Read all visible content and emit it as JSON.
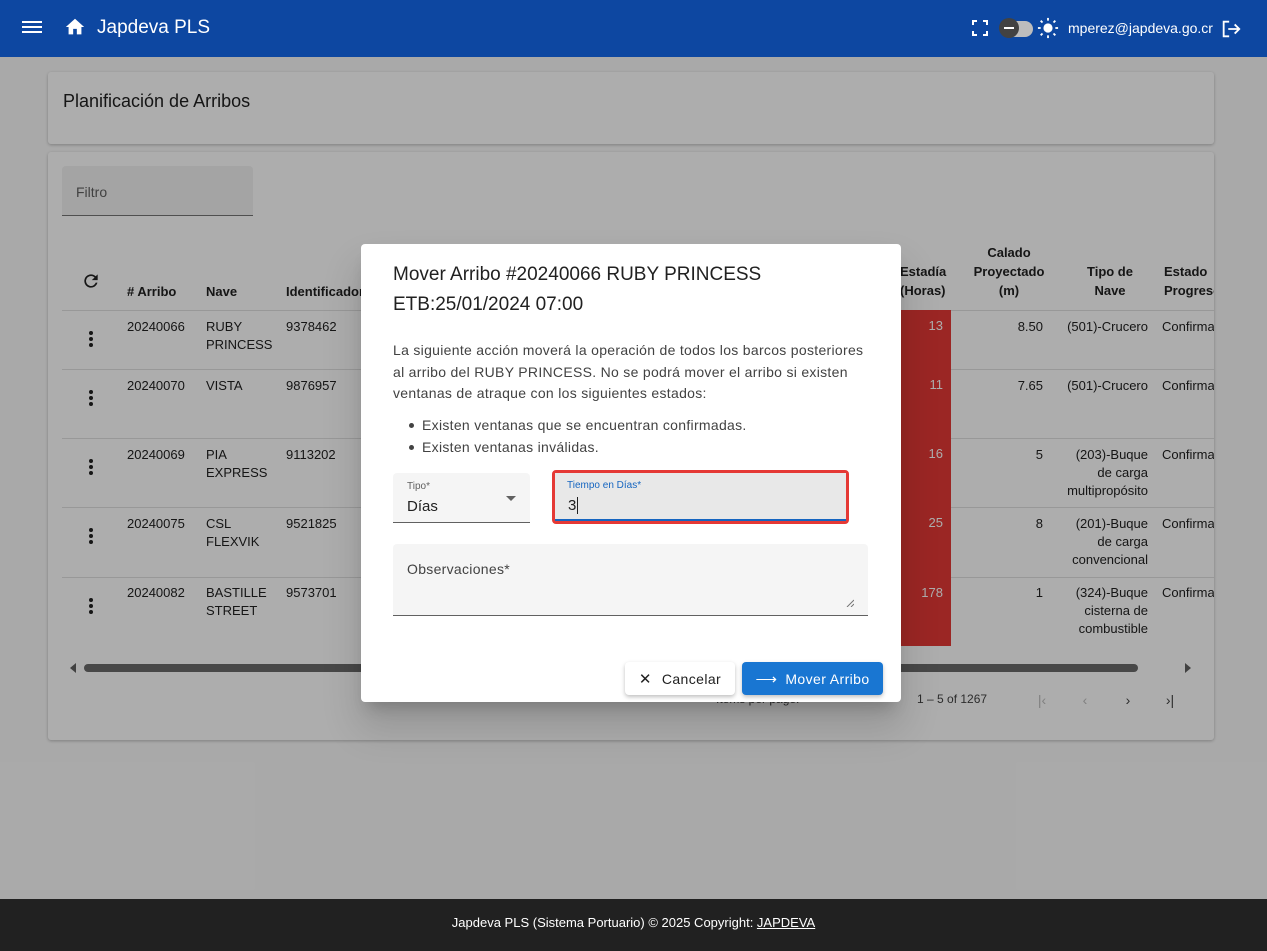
{
  "app": {
    "title": "Japdeva PLS",
    "user_email": "mperez@japdeva.go.cr"
  },
  "page": {
    "title": "Planificación de Arribos",
    "filter_label": "Filtro"
  },
  "table": {
    "headers": {
      "arribo": "# Arribo",
      "nave": "Nave",
      "identificador": "Identificador",
      "estadia_1": "Estadía",
      "estadia_2": "(Horas)",
      "calado_1": "Calado",
      "calado_2": "Proyectado",
      "calado_3": "(m)",
      "tipo_1": "Tipo de",
      "tipo_2": "Nave",
      "estado_1": "Estado",
      "estado_2": "Progreso"
    },
    "rows": [
      {
        "arribo": "20240066",
        "nave_1": "RUBY",
        "nave_2": "PRINCESS",
        "id": "9378462",
        "estadia": "13",
        "calado": "8.50",
        "tipo_1": "(501)-Crucero",
        "tipo_2": "",
        "tipo_3": "",
        "estado": "Confirmado"
      },
      {
        "arribo": "20240070",
        "nave_1": "VISTA",
        "nave_2": "",
        "id": "9876957",
        "estadia": "11",
        "calado": "7.65",
        "tipo_1": "(501)-Crucero",
        "tipo_2": "",
        "tipo_3": "",
        "estado": "Confirmado"
      },
      {
        "arribo": "20240069",
        "nave_1": "PIA",
        "nave_2": "EXPRESS",
        "id": "9113202",
        "estadia": "16",
        "calado": "5",
        "tipo_1": "(203)-Buque",
        "tipo_2": "de carga",
        "tipo_3": "multipropósito",
        "estado": "Confirmado"
      },
      {
        "arribo": "20240075",
        "nave_1": "CSL",
        "nave_2": "FLEXVIK",
        "id": "9521825",
        "estadia": "25",
        "calado": "8",
        "tipo_1": "(201)-Buque",
        "tipo_2": "de carga",
        "tipo_3": "convencional",
        "estado": "Confirmado"
      },
      {
        "arribo": "20240082",
        "nave_1": "BASTILLE",
        "nave_2": "STREET",
        "id": "9573701",
        "estadia": "178",
        "calado": "1",
        "tipo_1": "(324)-Buque",
        "tipo_2": "cisterna de",
        "tipo_3": "combustible",
        "estado": "Confirmado"
      }
    ],
    "paginator": {
      "items_per_page_label": "Items per page:",
      "range": "1 – 5 of 1267"
    }
  },
  "dialog": {
    "title_line1": "Mover Arribo #20240066 RUBY PRINCESS",
    "title_line2": "ETB:25/01/2024 07:00",
    "text": "La siguiente acción moverá la operación de todos los barcos posteriores al arribo del RUBY PRINCESS. No se podrá mover el arribo si existen ventanas de atraque con los siguientes estados:",
    "bullets": [
      "Existen ventanas que se encuentran confirmadas.",
      "Existen ventanas inválidas."
    ],
    "tipo_label": "Tipo*",
    "tipo_value": "Días",
    "tiempo_label": "Tiempo en Días*",
    "tiempo_value": "3",
    "observaciones_label": "Observaciones*",
    "cancel_label": "Cancelar",
    "move_label": "Mover Arribo"
  },
  "footer": {
    "text": "Japdeva PLS (Sistema Portuario) © 2025 Copyright: ",
    "link": "JAPDEVA"
  },
  "colors": {
    "topbar": "#0d47a1",
    "primary": "#1976d2",
    "stay_highlight": "#e53935",
    "footer": "#212121"
  }
}
